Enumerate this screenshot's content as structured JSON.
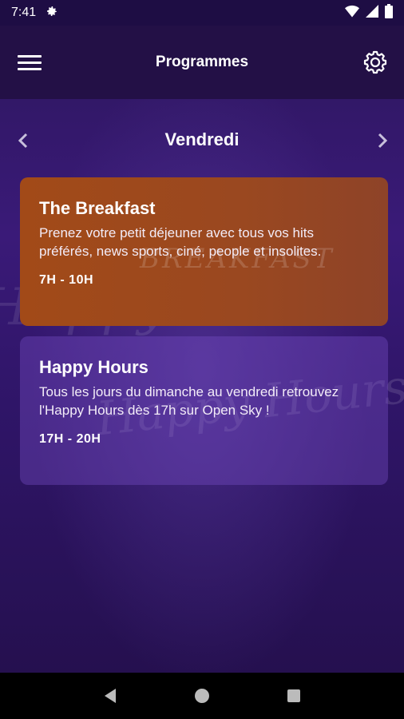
{
  "status_bar": {
    "time": "7:41",
    "icons": [
      "settings-icon",
      "wifi-icon",
      "signal-icon",
      "battery-icon"
    ]
  },
  "app_bar": {
    "title": "Programmes",
    "menu_icon": "hamburger-menu-icon",
    "settings_icon": "gear-icon"
  },
  "day_nav": {
    "day": "Vendredi",
    "prev_icon": "chevron-left-icon",
    "next_icon": "chevron-right-icon"
  },
  "programs": [
    {
      "title": "The Breakfast",
      "description": "Prenez votre petit déjeuner avec tous vos hits préférés, news sports, ciné, people et insolites.",
      "time": "7H - 10H",
      "color": "#a24a18"
    },
    {
      "title": "Happy Hours",
      "description": "Tous les jours du dimanche au vendredi retrouvez l'Happy Hours dès 17h sur Open Sky !",
      "time": "17H - 20H",
      "color": "#6a4ab0"
    }
  ],
  "nav_bar": {
    "back_icon": "back-triangle-icon",
    "home_icon": "home-circle-icon",
    "recents_icon": "recents-square-icon"
  },
  "colors": {
    "background": "#2c165c",
    "app_bar": "#231046",
    "accent_card": "#a24a18"
  }
}
